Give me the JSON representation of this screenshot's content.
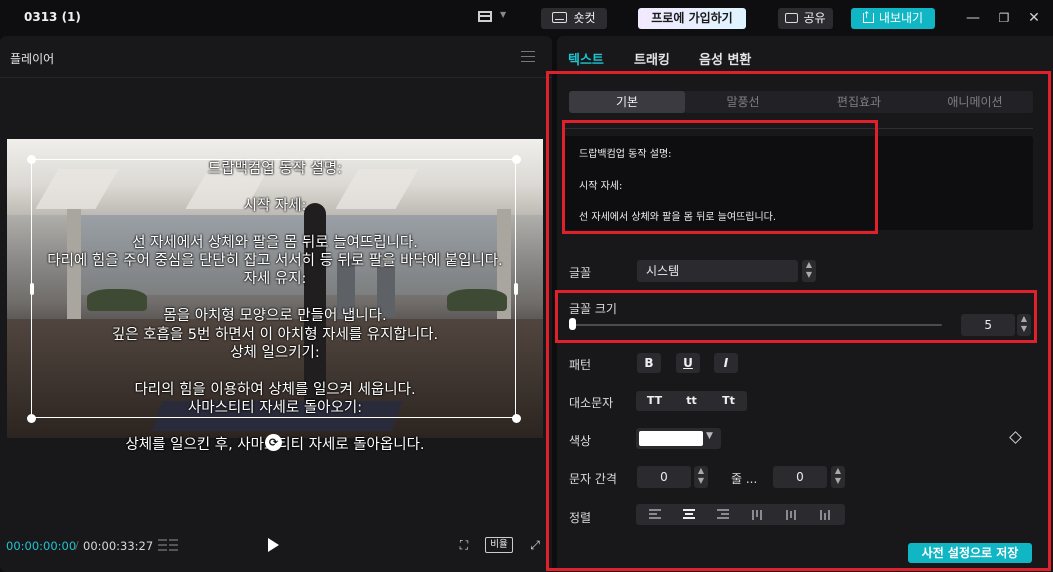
{
  "titlebar": {
    "project_name": "0313 (1)",
    "shortcut_label": "숏컷",
    "pro_label": "프로에 가입하기",
    "share_label": "공유",
    "export_label": "내보내기"
  },
  "player": {
    "title": "플레이어",
    "caption": "드랍백컴업 동작 설명:\n\n시작 자세:\n\n선 자세에서 상체와 팔을 몸 뒤로 늘여뜨립니다.\n다리에 힘을 주어 중심을 단단히 잡고 서서히 등 뒤로 팔을 바닥에 붙입니다.\n자세 유지:\n\n몸을 아치형 모양으로 만들어 냅니다.\n깊은 호흡을 5번 하면서 이 아치형 자세를 유지합니다.\n상체 일으키기:\n\n다리의 힘을 이용하여 상체를 일으켜 세웁니다.\n사마스티티 자세로 돌아오기:\n\n상체를 일으킨 후, 사마스티티 자세로 돌아옵니다.",
    "current_time": "00:00:00:00",
    "total_time": "00:00:33:27",
    "ratio_label": "비율"
  },
  "inspector": {
    "tabs": [
      "텍스트",
      "트래킹",
      "음성 변환"
    ],
    "active_tab": "텍스트",
    "subtabs": [
      "기본",
      "말풍선",
      "편집효과",
      "애니메이션"
    ],
    "active_subtab": "기본",
    "text_lines": [
      "드랍백컴업 동작 설명:",
      "시작 자세:",
      "선 자세에서 상체와 팔을 몸 뒤로 늘여뜨립니다."
    ],
    "font_label": "글꼴",
    "font_value": "시스템",
    "font_size_label": "글꼴 크기",
    "font_size_value": "5",
    "font_size_level": 0,
    "pattern_label": "패턴",
    "pattern_buttons": [
      "B",
      "U",
      "I"
    ],
    "case_label": "대소문자",
    "case_buttons": [
      "TT",
      "tt",
      "Tt"
    ],
    "color_label": "색상",
    "color_value": "#ffffff",
    "spacing_label": "문자 간격",
    "spacing_value": "0",
    "line_label": "줄 ...",
    "line_value": "0",
    "align_label": "정렬",
    "save_preset_label": "사전 설정으로 저장"
  },
  "colors": {
    "accent": "#1fc3cf",
    "highlight_frame": "#e0212b",
    "export_button": "#11b6c4"
  }
}
